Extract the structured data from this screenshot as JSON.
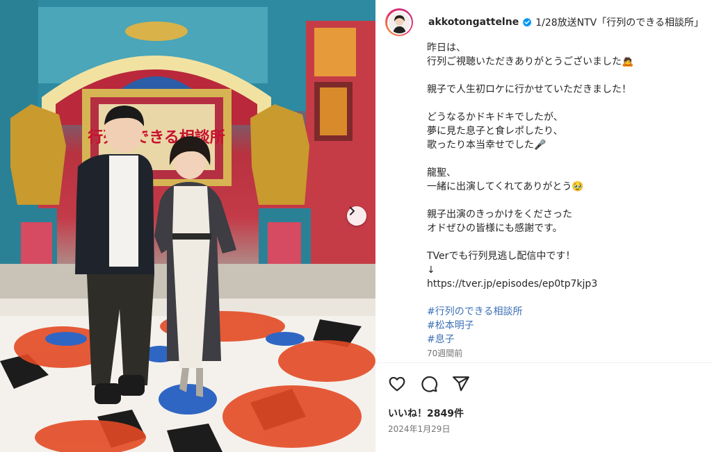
{
  "post": {
    "username": "akkotongattelne",
    "title": "1/28放送NTV「行列のできる相談所」",
    "caption_lines": [
      "昨日は、",
      "行列ご視聴いただきありがとうございました🙇",
      "",
      "親子で人生初ロケに行かせていただきました！",
      "",
      "どうなるかドキドキでしたが、",
      "夢に見た息子と食レポしたり、",
      "歌ったり本当幸せでした🎤",
      "",
      "龍聖、",
      "一緒に出演してくれてありがとう🥹",
      "",
      "親子出演のきっかけをくださった",
      "オドぜひの皆様にも感謝です。",
      "",
      "TVerでも行列見逃し配信中です！",
      "↓"
    ],
    "link": "https://tver.jp/episodes/ep0tp7kjp3",
    "hashtags": [
      "#行列のできる相談所",
      "#松本明子",
      "#息子"
    ],
    "relative_time": "70週間前",
    "likes": "いいね！2849件",
    "date": "2024年1月29日"
  },
  "photo": {
    "sign_text": "行列のできる相談所"
  },
  "icons": {
    "verified": "verified-badge-icon",
    "like": "heart-icon",
    "comment": "comment-icon",
    "share": "paper-plane-icon",
    "next": "chevron-right-icon"
  },
  "colors": {
    "verified_blue": "#0095f6",
    "hashtag_blue": "#3b6fb6",
    "secondary_text": "#737373"
  }
}
